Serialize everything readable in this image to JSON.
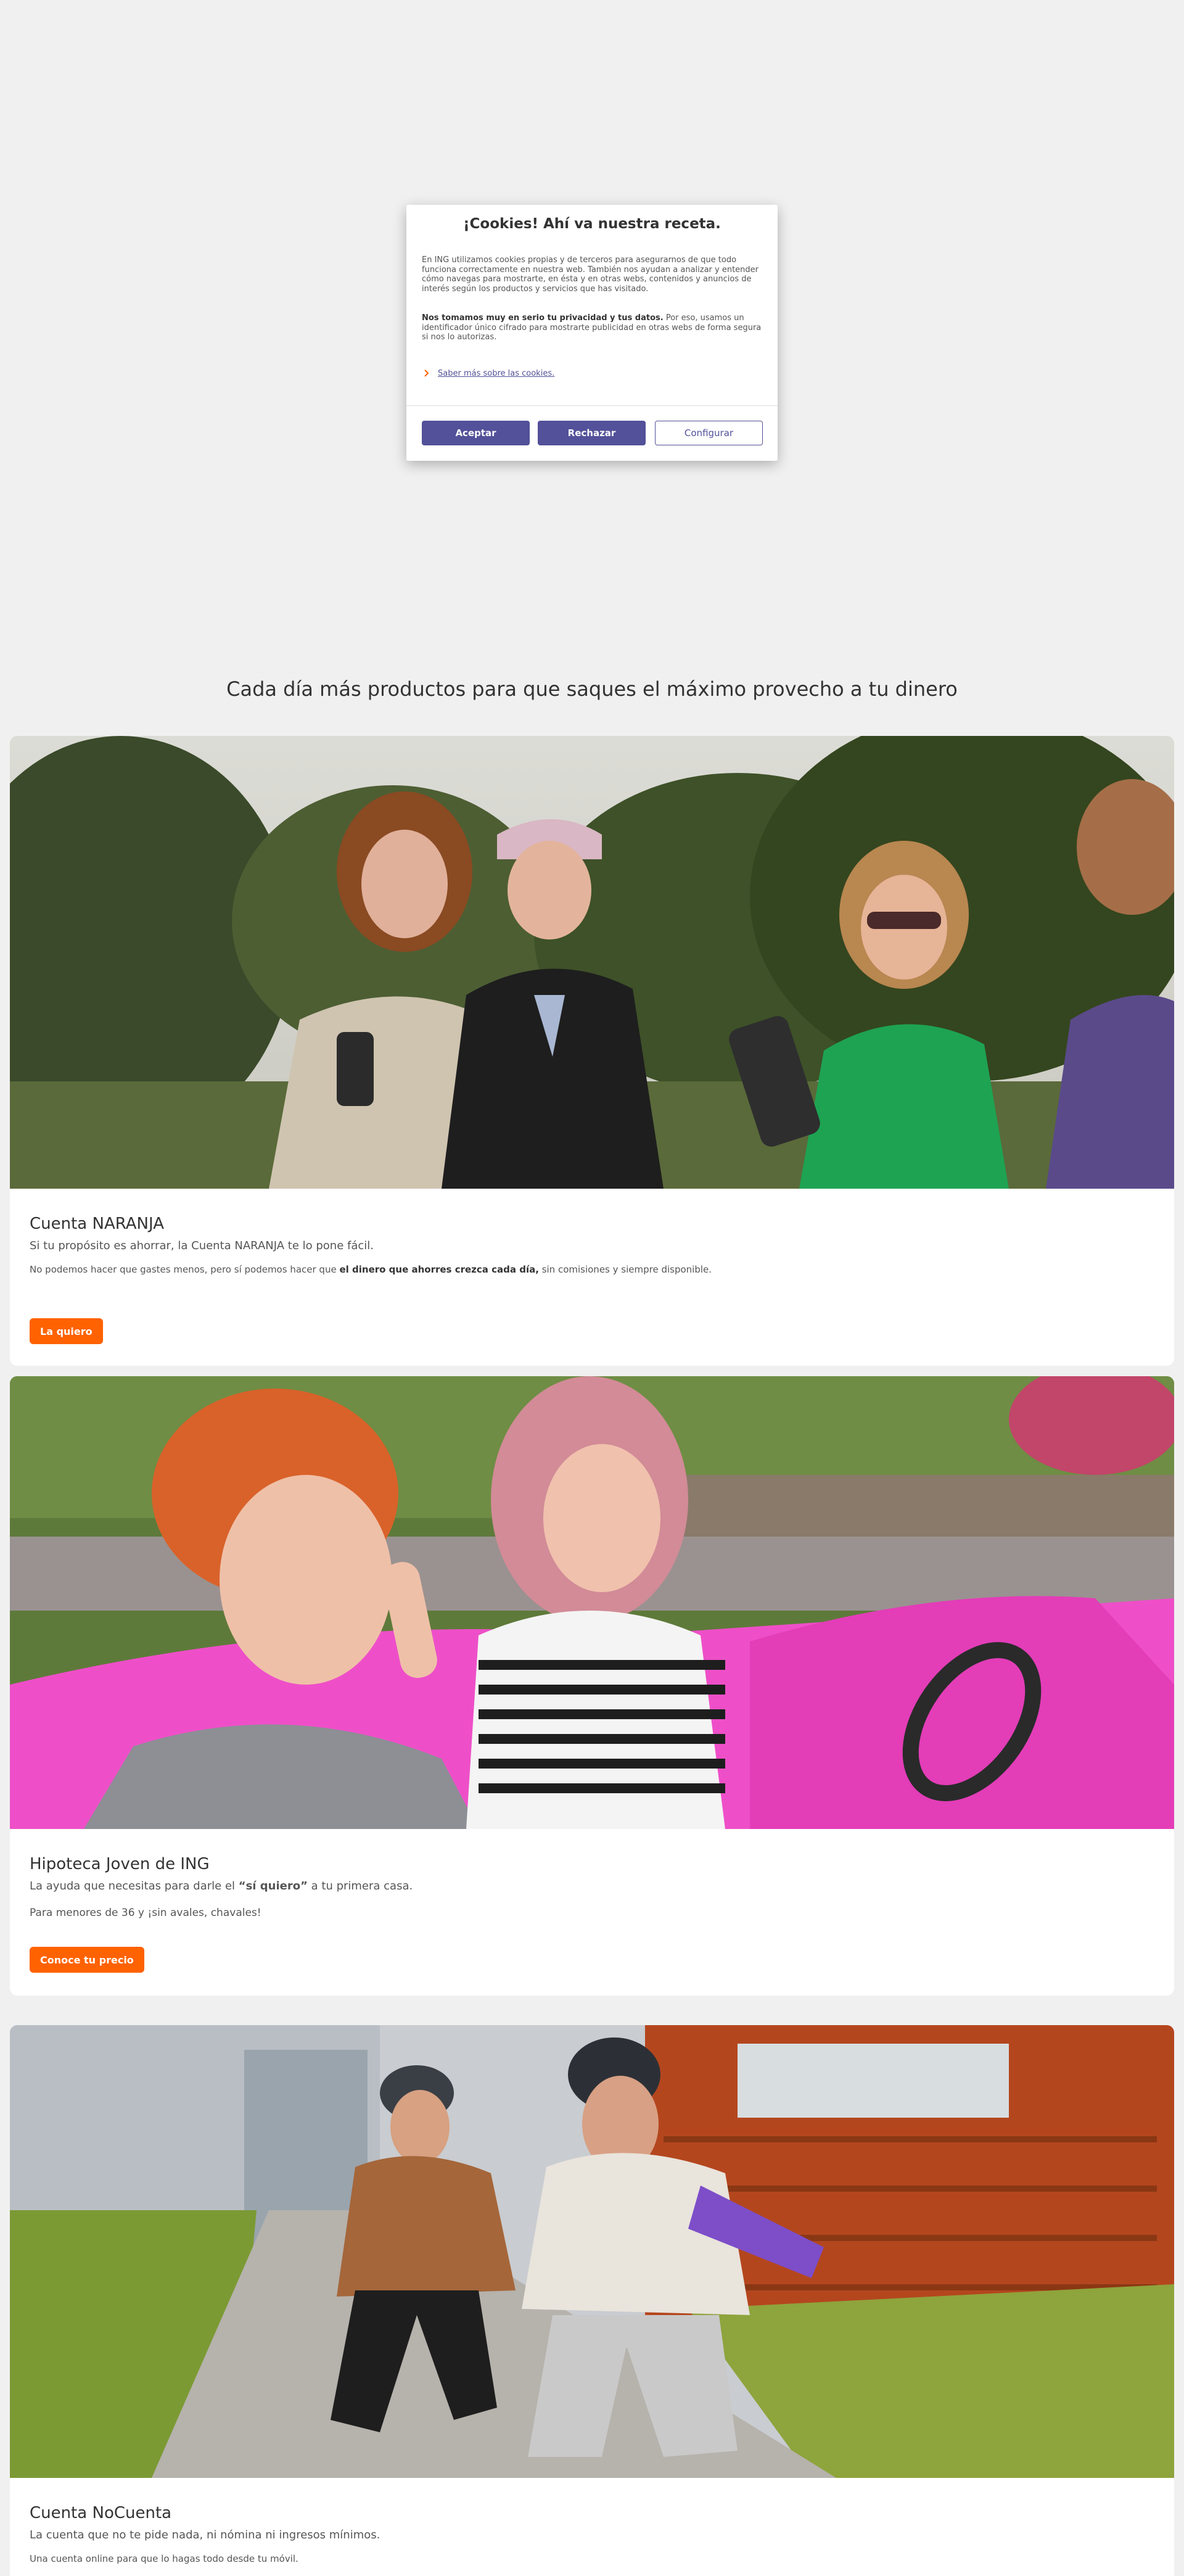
{
  "cookie_modal": {
    "title": "¡Cookies! Ahí va nuestra receta.",
    "intro": "En ING utilizamos cookies propias y de terceros para asegurarnos de que todo funciona correctamente en nuestra web. También nos ayudan a analizar y entender cómo navegas para mostrarte, en ésta y en otras webs, contenidos y anuncios de interés según los productos y servicios que has visitado.",
    "privacy_bold": "Nos tomamos muy en serio tu privacidad y tus datos.",
    "privacy_rest": " Por eso, usamos un identificador único cifrado para mostrarte publicidad en otras webs de forma segura si nos lo autorizas.",
    "learn_more": "Saber más sobre las cookies.",
    "accept": "Aceptar",
    "reject": "Rechazar",
    "configure": "Configurar"
  },
  "section": {
    "heading": "Cada día más productos para que saques el máximo provecho a tu dinero"
  },
  "cards": [
    {
      "title": "Cuenta NARANJA",
      "subtitle": "Si tu propósito es ahorrar, la Cuenta NARANJA te lo pone fácil.",
      "detail_pre": "No podemos hacer que gastes menos, pero sí podemos hacer que ",
      "detail_bold": "el dinero que ahorres crezca cada día,",
      "detail_post": " sin comisiones y siempre disponible.",
      "button": "La quiero"
    },
    {
      "title": "Hipoteca Joven de ING",
      "subtitle_pre": "La ayuda que necesitas para darle el ",
      "subtitle_bold": "“sí quiero”",
      "subtitle_post": " a tu primera casa.",
      "detail": "Para menores de 36 y ¡sin avales, chavales!",
      "button": "Conoce tu precio"
    },
    {
      "title": "Cuenta NoCuenta",
      "subtitle": "La cuenta que no te pide nada, ni nómina ni ingresos mínimos.",
      "detail": "Una cuenta online para que lo hagas todo desde tu móvil."
    }
  ],
  "colors": {
    "page_bg": "#f0f0f0",
    "brand_orange": "#ff6200",
    "modal_button": "#525199"
  }
}
